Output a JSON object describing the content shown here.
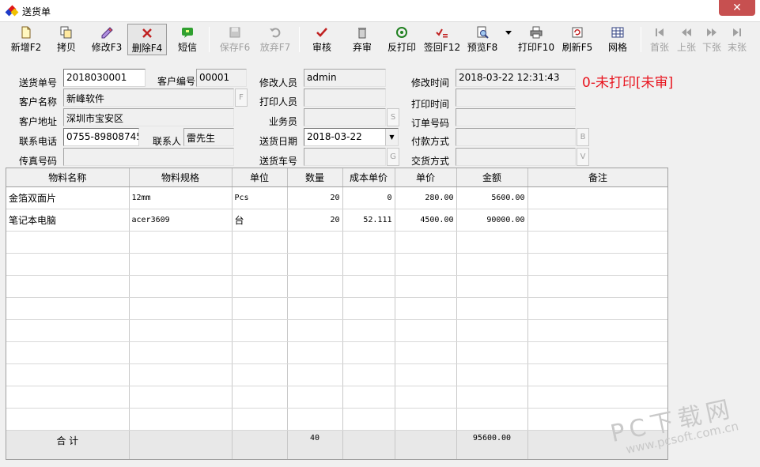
{
  "window": {
    "title": "送货单",
    "close_glyph": "✕"
  },
  "toolbar": {
    "new": "新增F2",
    "copy": "拷贝",
    "edit": "修改F3",
    "delete": "删除F4",
    "sms": "短信",
    "save": "保存F6",
    "discard": "放弃F7",
    "audit": "审核",
    "unaudit": "弃审",
    "unprint": "反打印",
    "signback": "签回F12",
    "preview": "预览F8",
    "print": "打印F10",
    "refresh": "刷新F5",
    "grid": "网格",
    "first": "首张",
    "prev": "上张",
    "next": "下张",
    "last": "末张"
  },
  "form": {
    "delivery_no_label": "送货单号",
    "delivery_no": "2018030001",
    "customer_no_label": "客户编号",
    "customer_no": "00001",
    "customer_name_label": "客户名称",
    "customer_name": "新峰软件",
    "customer_addr_label": "客户地址",
    "customer_addr": "深圳市宝安区",
    "phone_label": "联系电话",
    "phone": "0755-89808745",
    "contact_label": "联系人",
    "contact": "雷先生",
    "fax_label": "传真号码",
    "fax": "",
    "modifier_label": "修改人员",
    "modifier": "admin",
    "printer_label": "打印人员",
    "printer": "",
    "salesman_label": "业务员",
    "salesman": "",
    "delivery_date_label": "送货日期",
    "delivery_date": "2018-03-22",
    "vehicle_label": "送货车号",
    "vehicle": "",
    "modify_time_label": "修改时间",
    "modify_time": "2018-03-22 12:31:43",
    "print_time_label": "打印时间",
    "print_time": "",
    "order_no_label": "订单号码",
    "order_no": "",
    "payment_label": "付款方式",
    "payment": "",
    "delivery_method_label": "交货方式",
    "delivery_method": "",
    "btn_f": "F",
    "btn_s": "S",
    "btn_g": "G",
    "btn_b": "B",
    "btn_v": "V",
    "status": "0-未打印[未审]"
  },
  "grid": {
    "headers": [
      "物料名称",
      "物料规格",
      "单位",
      "数量",
      "成本单价",
      "单价",
      "金额",
      "备注"
    ],
    "rows": [
      [
        "金箔双面片",
        "12mm",
        "Pcs",
        "20",
        "0",
        "280.00",
        "5600.00",
        ""
      ],
      [
        "笔记本电脑",
        "acer3609",
        "台",
        "20",
        "52.111",
        "4500.00",
        "90000.00",
        ""
      ]
    ],
    "total": {
      "label": "合 计",
      "qty": "40",
      "amount": "95600.00"
    }
  },
  "watermark": {
    "line1": "PC下载网",
    "line2": "www.pcsoft.com.cn"
  },
  "colors": {
    "status_red": "#e8141e",
    "close_red": "#c75050"
  }
}
